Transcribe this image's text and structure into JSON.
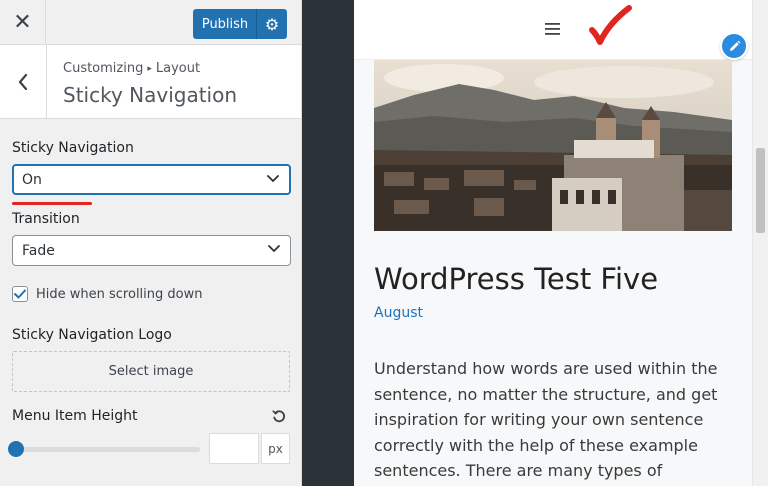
{
  "topbar": {
    "close_icon": "close-icon",
    "publish_label": "Publish",
    "gear_icon": "gear-icon"
  },
  "section": {
    "breadcrumb_root": "Customizing",
    "breadcrumb_separator": "▸",
    "breadcrumb_current": "Layout",
    "title": "Sticky Navigation"
  },
  "controls": {
    "sticky_nav_label": "Sticky Navigation",
    "sticky_nav_value": "On",
    "transition_label": "Transition",
    "transition_value": "Fade",
    "hide_scrolling_label": "Hide when scrolling down",
    "hide_scrolling_checked": true,
    "logo_label": "Sticky Navigation Logo",
    "select_image_label": "Select image",
    "menu_height_label": "Menu Item Height",
    "menu_height_value": "",
    "menu_height_unit": "px",
    "menu_height_slider_fraction": 0
  },
  "preview": {
    "post_title": "WordPress Test Five",
    "post_date": "August",
    "post_body": "Understand how words are used within the sentence, no matter the structure, and get inspiration for writing your own sentence correctly with the help of these example sentences. There are many types of"
  },
  "colors": {
    "accent": "#2271b1",
    "annotation_red": "#e0261f",
    "edit_button": "#2a8be0"
  }
}
